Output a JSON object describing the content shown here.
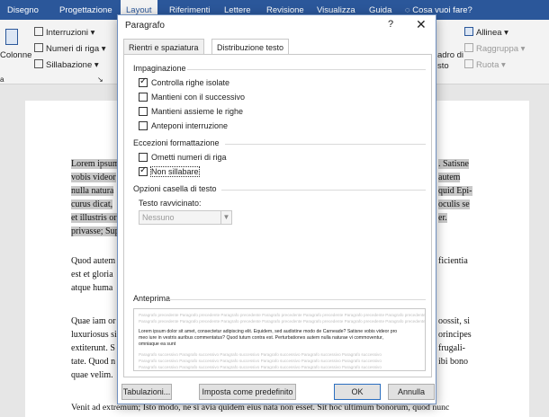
{
  "ribbon_tabs": [
    {
      "label": "Disegno"
    },
    {
      "label": "Progettazione"
    },
    {
      "label": "Layout"
    },
    {
      "label": "Riferimenti"
    },
    {
      "label": "Lettere"
    },
    {
      "label": "Revisione"
    },
    {
      "label": "Visualizza"
    },
    {
      "label": "Guida"
    }
  ],
  "tell_me": "Cosa vuoi fare?",
  "ribbon": {
    "colonne": "Colonne",
    "interruzioni": "Interruzioni",
    "numeri_riga": "Numeri di riga",
    "sillabazione": "Sillabazione",
    "group_label": "a",
    "quadro": "adro di",
    "testo": "sto",
    "allinea": "Allinea",
    "raggruppa": "Raggruppa",
    "ruota": "Ruota"
  },
  "document": {
    "left_lines": [
      "Lorem ipsum",
      "vobis videor",
      "nulla natura",
      "curus dicat,",
      "et illustris or",
      "privasse; Sup",
      "",
      "Quod autem",
      "est et gloria",
      "atque huma",
      "",
      "Quae iam or",
      "luxuriosus si",
      "extiterunt. S",
      "tate. Quod n",
      "quae velim."
    ],
    "right_lines": [
      ". Satisne",
      "autem",
      "quid Epi-",
      "oculis se",
      "er.",
      "",
      "ficientia",
      "",
      "",
      "oossit, si",
      "orincipes",
      "frugali-",
      "ibi bono"
    ],
    "bottom_line": "Venit ad extremum; Isto modo, ne si avia quidem eius nata non esset. Sit hoc ultimum bonorum, quod nunc"
  },
  "dialog": {
    "title": "Paragrafo",
    "help": "?",
    "close": "✕",
    "tabs": [
      {
        "label": "Rientri e spaziatura",
        "active": false
      },
      {
        "label": "Distribuzione testo",
        "active": true
      }
    ],
    "pagination": {
      "title": "Impaginazione",
      "options": [
        {
          "label": "Controlla righe isolate",
          "checked": true
        },
        {
          "label": "Mantieni con il successivo",
          "checked": false
        },
        {
          "label": "Mantieni assieme le righe",
          "checked": false
        },
        {
          "label": "Anteponi interruzione",
          "checked": false
        }
      ]
    },
    "exceptions": {
      "title": "Eccezioni formattazione",
      "options": [
        {
          "label": "Ometti numeri di riga",
          "checked": false
        },
        {
          "label": "Non sillabare",
          "checked": true
        }
      ]
    },
    "textbox": {
      "title": "Opzioni casella di testo",
      "tight_wrap_label": "Testo ravvicinato:",
      "tight_wrap_value": "Nessuno"
    },
    "preview": {
      "title": "Anteprima",
      "prev_text": "Paragrafo precedente Paragrafo precedente Paragrafo precedente Paragrafo precedente Paragrafo precedente Paragrafo precedente Paragrafo precedente",
      "main_1": "Lorem ipsum dolor sit amet, consectetur adipiscing elit. Equidem, sed audistine modo de Carneade? Satisne vobis videor pro",
      "main_2": "meo iure in vestris auribus commentatus? Quod tutum contra est. Perturbationes autem nulla naturae vi commoventur,",
      "main_3": "omniaque ea sunt",
      "next_text": "Paragrafo successivo Paragrafo successivo Paragrafo successivo Paragrafo successivo Paragrafo successivo Paragrafo successivo"
    },
    "buttons": {
      "tabs": "Tabulazioni...",
      "default": "Imposta come predefinito",
      "ok": "OK",
      "cancel": "Annulla"
    }
  }
}
